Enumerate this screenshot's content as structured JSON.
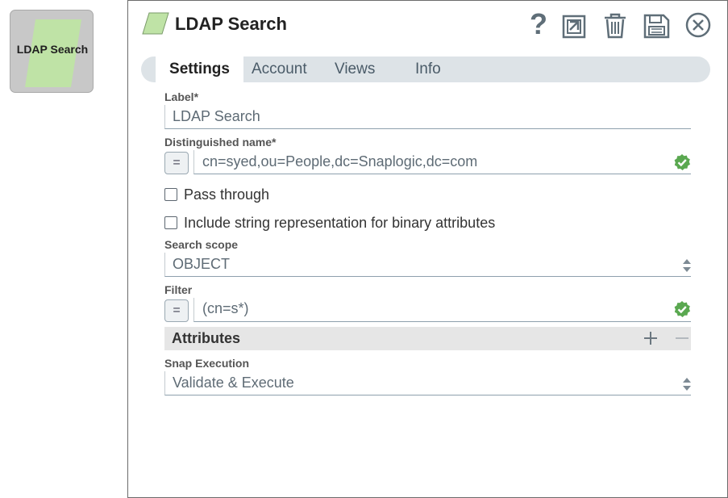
{
  "snap_tile": {
    "label": "LDAP Search"
  },
  "dialog": {
    "title": "LDAP Search",
    "toolbar": [
      "help-icon",
      "export-icon",
      "delete-icon",
      "save-icon",
      "close-icon"
    ]
  },
  "tabs": [
    {
      "label": "Settings",
      "active": true
    },
    {
      "label": "Account"
    },
    {
      "label": "Views"
    },
    {
      "label": "Info"
    }
  ],
  "fields": {
    "label": {
      "label": "Label*",
      "value": "LDAP Search"
    },
    "dn": {
      "label": "Distinguished name*",
      "expr": "=",
      "value": "cn=syed,ou=People,dc=Snaplogic,dc=com"
    },
    "pass_through": {
      "label": "Pass through"
    },
    "binary_attrs": {
      "label": "Include string representation for binary attributes"
    },
    "search_scope": {
      "label": "Search scope",
      "value": "OBJECT"
    },
    "filter": {
      "label": "Filter",
      "expr": "=",
      "value": "(cn=s*)"
    },
    "attributes": {
      "label": "Attributes"
    },
    "snap_execution": {
      "label": "Snap Execution",
      "value": "Validate & Execute"
    }
  },
  "colors": {
    "accent_green": "#5aa850",
    "snap_green": "#bfe3a6",
    "tab_bg": "#dde3e7"
  }
}
